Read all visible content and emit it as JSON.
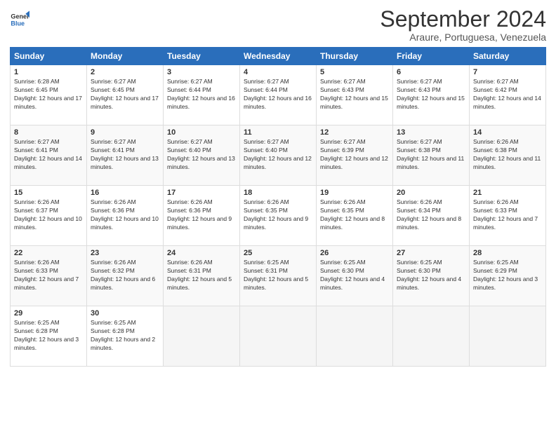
{
  "logo": {
    "line1": "General",
    "line2": "Blue"
  },
  "title": "September 2024",
  "subtitle": "Araure, Portuguesa, Venezuela",
  "days_header": [
    "Sunday",
    "Monday",
    "Tuesday",
    "Wednesday",
    "Thursday",
    "Friday",
    "Saturday"
  ],
  "weeks": [
    [
      {
        "day": "1",
        "sunrise": "6:28 AM",
        "sunset": "6:45 PM",
        "daylight": "12 hours and 17 minutes."
      },
      {
        "day": "2",
        "sunrise": "6:27 AM",
        "sunset": "6:45 PM",
        "daylight": "12 hours and 17 minutes."
      },
      {
        "day": "3",
        "sunrise": "6:27 AM",
        "sunset": "6:44 PM",
        "daylight": "12 hours and 16 minutes."
      },
      {
        "day": "4",
        "sunrise": "6:27 AM",
        "sunset": "6:44 PM",
        "daylight": "12 hours and 16 minutes."
      },
      {
        "day": "5",
        "sunrise": "6:27 AM",
        "sunset": "6:43 PM",
        "daylight": "12 hours and 15 minutes."
      },
      {
        "day": "6",
        "sunrise": "6:27 AM",
        "sunset": "6:43 PM",
        "daylight": "12 hours and 15 minutes."
      },
      {
        "day": "7",
        "sunrise": "6:27 AM",
        "sunset": "6:42 PM",
        "daylight": "12 hours and 14 minutes."
      }
    ],
    [
      {
        "day": "8",
        "sunrise": "6:27 AM",
        "sunset": "6:41 PM",
        "daylight": "12 hours and 14 minutes."
      },
      {
        "day": "9",
        "sunrise": "6:27 AM",
        "sunset": "6:41 PM",
        "daylight": "12 hours and 13 minutes."
      },
      {
        "day": "10",
        "sunrise": "6:27 AM",
        "sunset": "6:40 PM",
        "daylight": "12 hours and 13 minutes."
      },
      {
        "day": "11",
        "sunrise": "6:27 AM",
        "sunset": "6:40 PM",
        "daylight": "12 hours and 12 minutes."
      },
      {
        "day": "12",
        "sunrise": "6:27 AM",
        "sunset": "6:39 PM",
        "daylight": "12 hours and 12 minutes."
      },
      {
        "day": "13",
        "sunrise": "6:27 AM",
        "sunset": "6:38 PM",
        "daylight": "12 hours and 11 minutes."
      },
      {
        "day": "14",
        "sunrise": "6:26 AM",
        "sunset": "6:38 PM",
        "daylight": "12 hours and 11 minutes."
      }
    ],
    [
      {
        "day": "15",
        "sunrise": "6:26 AM",
        "sunset": "6:37 PM",
        "daylight": "12 hours and 10 minutes."
      },
      {
        "day": "16",
        "sunrise": "6:26 AM",
        "sunset": "6:36 PM",
        "daylight": "12 hours and 10 minutes."
      },
      {
        "day": "17",
        "sunrise": "6:26 AM",
        "sunset": "6:36 PM",
        "daylight": "12 hours and 9 minutes."
      },
      {
        "day": "18",
        "sunrise": "6:26 AM",
        "sunset": "6:35 PM",
        "daylight": "12 hours and 9 minutes."
      },
      {
        "day": "19",
        "sunrise": "6:26 AM",
        "sunset": "6:35 PM",
        "daylight": "12 hours and 8 minutes."
      },
      {
        "day": "20",
        "sunrise": "6:26 AM",
        "sunset": "6:34 PM",
        "daylight": "12 hours and 8 minutes."
      },
      {
        "day": "21",
        "sunrise": "6:26 AM",
        "sunset": "6:33 PM",
        "daylight": "12 hours and 7 minutes."
      }
    ],
    [
      {
        "day": "22",
        "sunrise": "6:26 AM",
        "sunset": "6:33 PM",
        "daylight": "12 hours and 7 minutes."
      },
      {
        "day": "23",
        "sunrise": "6:26 AM",
        "sunset": "6:32 PM",
        "daylight": "12 hours and 6 minutes."
      },
      {
        "day": "24",
        "sunrise": "6:26 AM",
        "sunset": "6:31 PM",
        "daylight": "12 hours and 5 minutes."
      },
      {
        "day": "25",
        "sunrise": "6:25 AM",
        "sunset": "6:31 PM",
        "daylight": "12 hours and 5 minutes."
      },
      {
        "day": "26",
        "sunrise": "6:25 AM",
        "sunset": "6:30 PM",
        "daylight": "12 hours and 4 minutes."
      },
      {
        "day": "27",
        "sunrise": "6:25 AM",
        "sunset": "6:30 PM",
        "daylight": "12 hours and 4 minutes."
      },
      {
        "day": "28",
        "sunrise": "6:25 AM",
        "sunset": "6:29 PM",
        "daylight": "12 hours and 3 minutes."
      }
    ],
    [
      {
        "day": "29",
        "sunrise": "6:25 AM",
        "sunset": "6:28 PM",
        "daylight": "12 hours and 3 minutes."
      },
      {
        "day": "30",
        "sunrise": "6:25 AM",
        "sunset": "6:28 PM",
        "daylight": "12 hours and 2 minutes."
      },
      null,
      null,
      null,
      null,
      null
    ]
  ],
  "labels": {
    "sunrise": "Sunrise: ",
    "sunset": "Sunset: ",
    "daylight": "Daylight: "
  }
}
